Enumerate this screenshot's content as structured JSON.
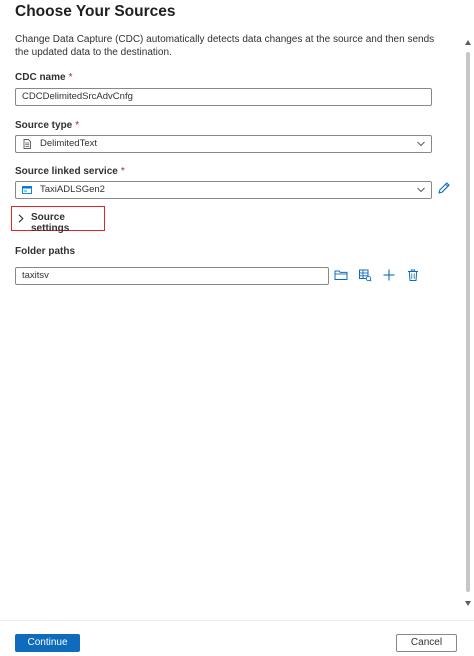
{
  "panel": {
    "title": "Choose Your Sources",
    "description": "Change Data Capture (CDC) automatically detects data changes at the source and then sends the updated data to the destination."
  },
  "fields": {
    "cdc_name": {
      "label": "CDC name",
      "required_mark": "*",
      "value": "CDCDelimitedSrcAdvCnfg"
    },
    "source_type": {
      "label": "Source type",
      "required_mark": "*",
      "value": "DelimitedText",
      "icon": "delimited-text-file-icon"
    },
    "linked_service": {
      "label": "Source linked service",
      "required_mark": "*",
      "value": "TaxiADLSGen2",
      "icon": "adls-gen2-icon",
      "edit_icon": "pencil-icon"
    }
  },
  "source_settings": {
    "label": "Source settings",
    "expanded": false
  },
  "folder_paths": {
    "label": "Folder paths",
    "value": "taxitsv",
    "tools": [
      "folder-icon",
      "grid-preview-icon",
      "plus-icon",
      "trash-icon"
    ]
  },
  "footer": {
    "continue_label": "Continue",
    "cancel_label": "Cancel"
  },
  "colors": {
    "accent": "#0f6cbd",
    "highlight_border": "#e3222c",
    "required": "#a4262c"
  }
}
